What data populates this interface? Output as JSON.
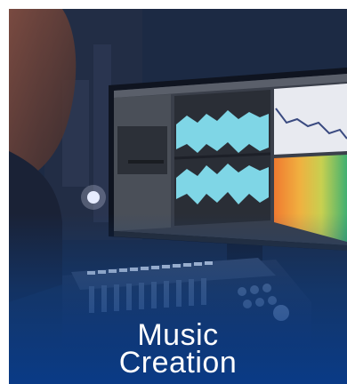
{
  "caption": {
    "line1": "Music",
    "line2": "Creation"
  },
  "colors": {
    "overlay": "#0d3f86",
    "text": "#ffffff",
    "waveform": "#7fd6e6",
    "spectrogram_hot": "#f0a030",
    "spectrogram_cool": "#3ab87a"
  }
}
